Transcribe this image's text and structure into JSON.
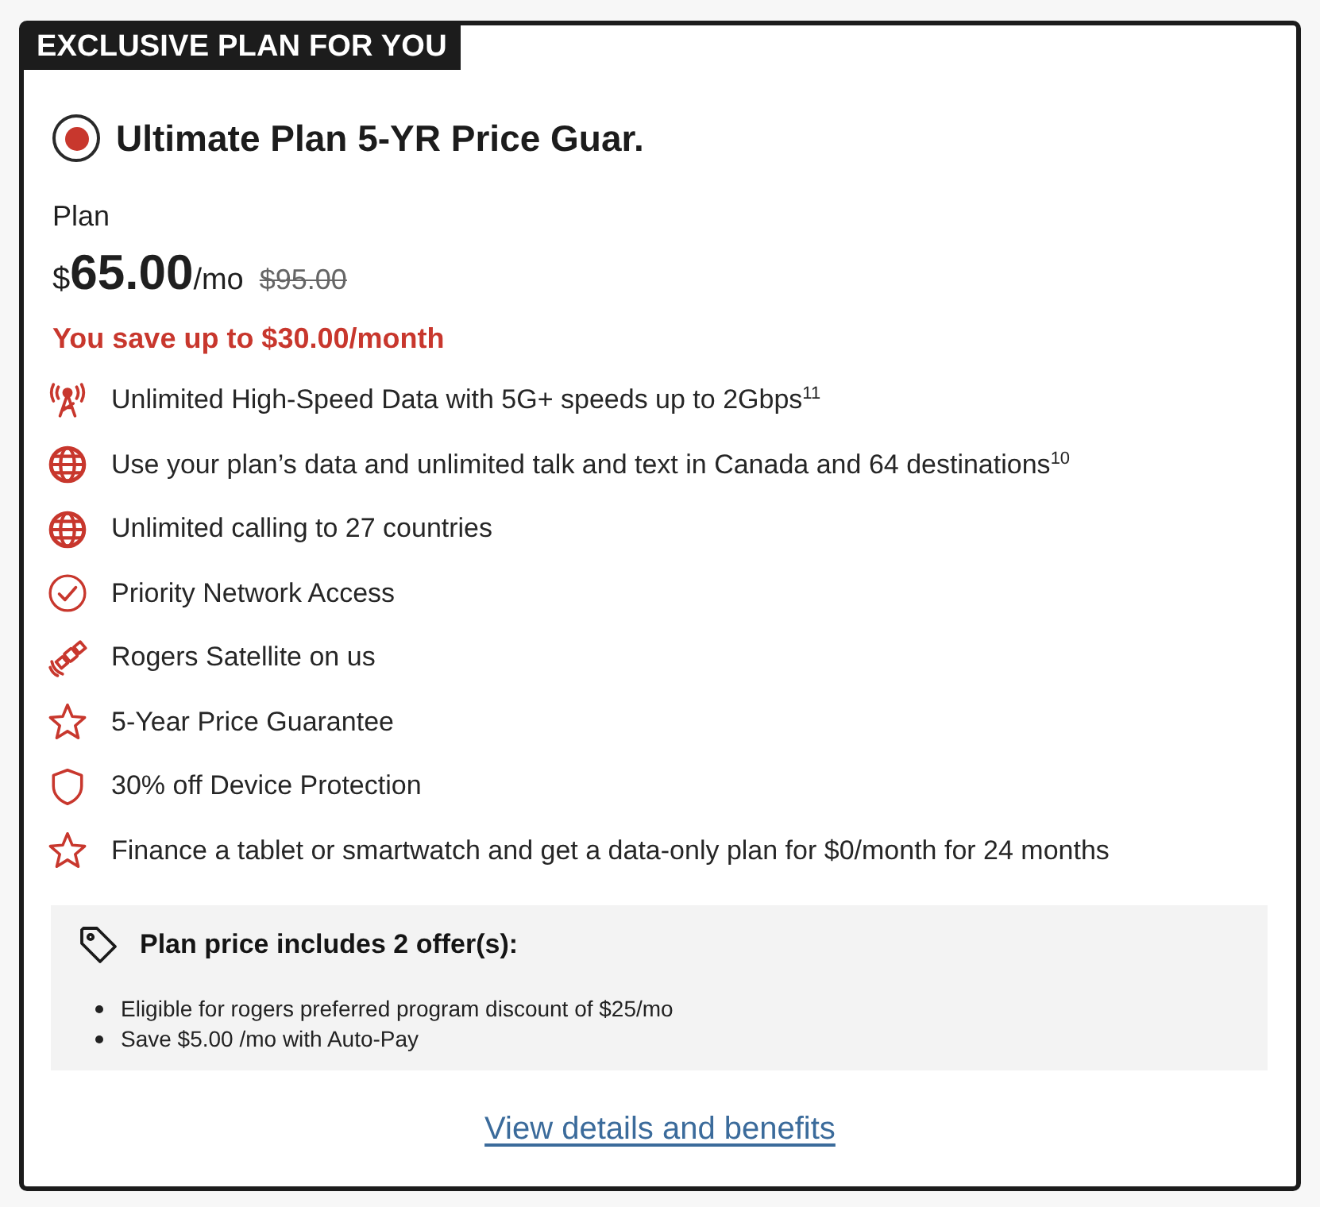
{
  "badge": {
    "text": "EXCLUSIVE PLAN FOR YOU"
  },
  "plan": {
    "name": "Ultimate Plan 5-YR Price Guar.",
    "selected": true,
    "label": "Plan",
    "currency": "$",
    "amount": "65.00",
    "period": "/mo",
    "original_price": "$95.00",
    "savings": "You save up to $30.00/month"
  },
  "features": [
    {
      "kind": "antenna",
      "text": "Unlimited High-Speed Data with 5G+ speeds up to 2Gbps$^{11}$"
    },
    {
      "kind": "globe",
      "text": "Use your plan’s data and unlimited talk and text in Canada and 64 destinations$^{10}$"
    },
    {
      "kind": "globe",
      "text": "Unlimited calling to 27 countries"
    },
    {
      "kind": "check",
      "text": "Priority Network Access"
    },
    {
      "kind": "satellite",
      "text": "Rogers Satellite on us"
    },
    {
      "kind": "star",
      "text": "5-Year Price Guarantee"
    },
    {
      "kind": "shield",
      "text": "30% off Device Protection"
    },
    {
      "kind": "star",
      "text": "Finance a tablet or smartwatch and get a data-only plan for $0/month for 24 months"
    }
  ],
  "offers": {
    "title": "Plan price includes 2 offer(s):",
    "items": [
      "Eligible for rogers preferred program discount of $25/mo",
      "Save $5.00 /mo with Auto-Pay"
    ]
  },
  "link": {
    "text": "View details and benefits"
  }
}
